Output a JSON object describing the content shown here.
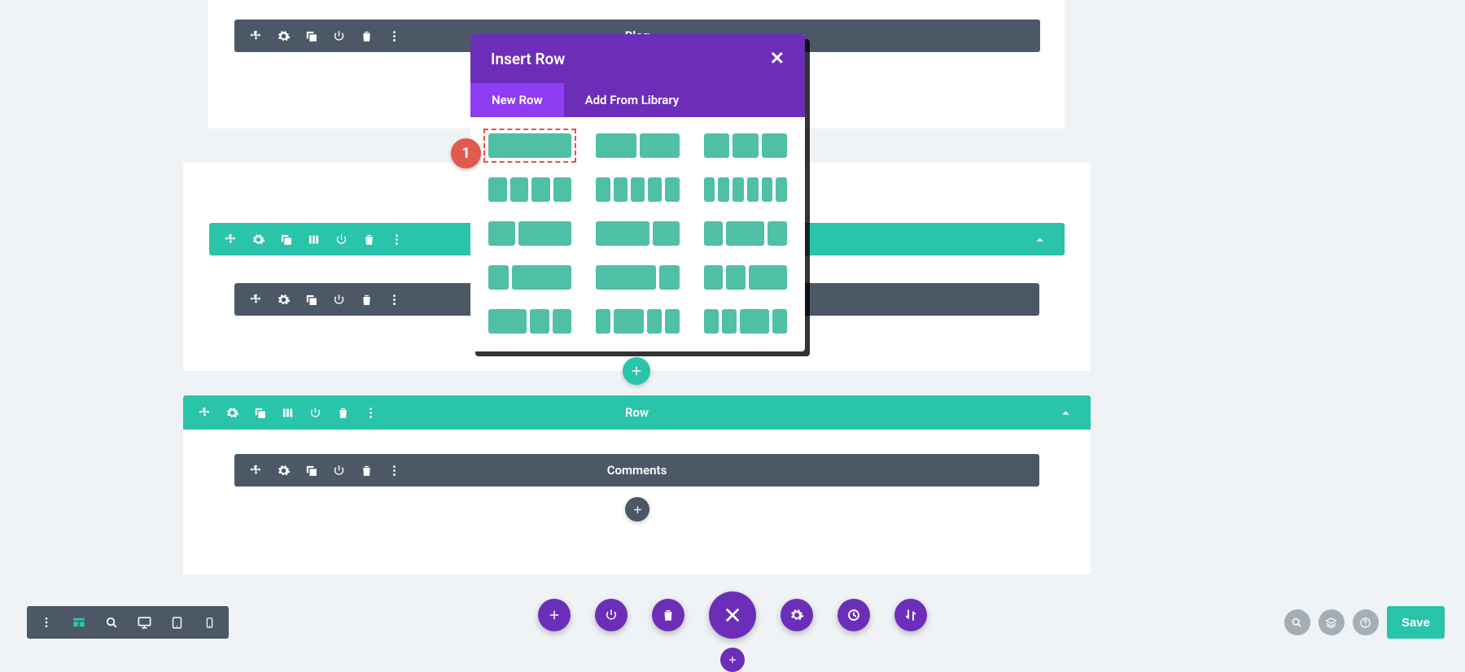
{
  "modules": {
    "blog": "Blog",
    "comments": "Comments",
    "row": "Row"
  },
  "popup": {
    "title": "Insert Row",
    "tab_new": "New Row",
    "tab_library": "Add From Library"
  },
  "callout": "1",
  "bottom_right": {
    "save": "Save"
  },
  "layouts": [
    [
      1
    ],
    [
      1,
      1
    ],
    [
      1,
      1,
      1
    ],
    [
      1,
      1,
      1,
      1
    ],
    [
      1,
      1,
      1,
      1,
      1
    ],
    [
      1,
      1,
      1,
      1,
      1,
      1
    ],
    [
      1,
      2
    ],
    [
      2,
      1
    ],
    [
      1,
      2,
      1
    ],
    [
      1,
      3
    ],
    [
      3,
      1
    ],
    [
      1,
      1,
      2
    ],
    [
      2,
      1,
      1
    ],
    [
      1,
      2,
      1,
      1
    ],
    [
      1,
      1,
      2,
      1
    ]
  ]
}
